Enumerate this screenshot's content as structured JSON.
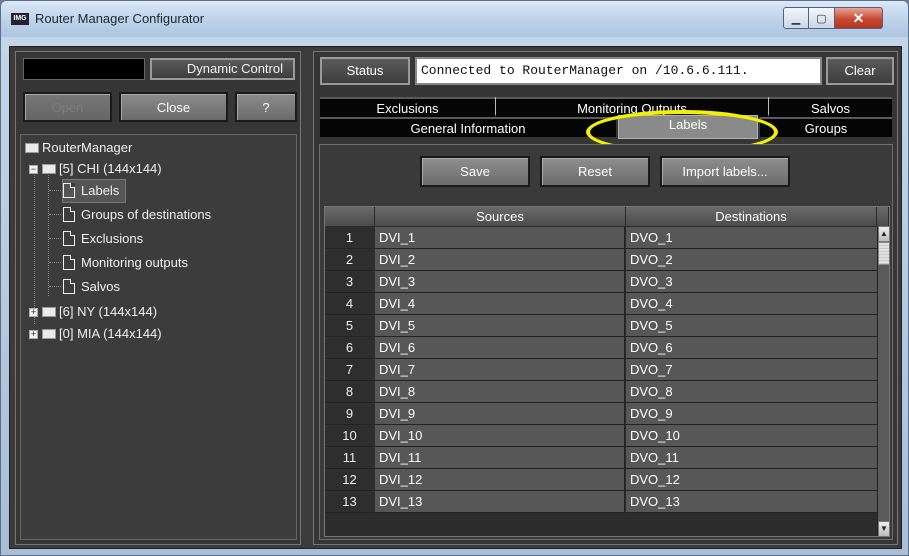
{
  "window": {
    "title": "Router Manager Configurator",
    "icon_text": "IMG",
    "minimize_symbol": "▁",
    "maximize_symbol": "▢",
    "close_symbol": "✕"
  },
  "left": {
    "dynamic_control_label": "Dynamic Control",
    "buttons": {
      "open": "Open",
      "close": "Close",
      "help": "?"
    },
    "tree": {
      "root": "RouterManager",
      "nodes": [
        {
          "label": "[5] CHI (144x144)",
          "expander": "−"
        },
        {
          "label": "[6] NY (144x144)",
          "expander": "+"
        },
        {
          "label": "[0] MIA (144x144)",
          "expander": "+"
        }
      ],
      "children": [
        "Labels",
        "Groups of destinations",
        "Exclusions",
        "Monitoring outputs",
        "Salvos"
      ]
    }
  },
  "right": {
    "status_label": "Status",
    "status_text": "Connected to RouterManager on /10.6.6.111.",
    "clear_label": "Clear",
    "tabs_row1": [
      "Exclusions",
      "Monitoring Outputs",
      "Salvos"
    ],
    "tabs_row2": [
      "General Information",
      "Labels",
      "Groups"
    ],
    "active_tab": "Labels",
    "actions": {
      "save": "Save",
      "reset": "Reset",
      "import": "Import labels..."
    },
    "table": {
      "headers": [
        "",
        "Sources",
        "Destinations"
      ],
      "rows": [
        [
          "1",
          "DVI_1",
          "DVO_1"
        ],
        [
          "2",
          "DVI_2",
          "DVO_2"
        ],
        [
          "3",
          "DVI_3",
          "DVO_3"
        ],
        [
          "4",
          "DVI_4",
          "DVO_4"
        ],
        [
          "5",
          "DVI_5",
          "DVO_5"
        ],
        [
          "6",
          "DVI_6",
          "DVO_6"
        ],
        [
          "7",
          "DVI_7",
          "DVO_7"
        ],
        [
          "8",
          "DVI_8",
          "DVO_8"
        ],
        [
          "9",
          "DVI_9",
          "DVO_9"
        ],
        [
          "10",
          "DVI_10",
          "DVO_10"
        ],
        [
          "11",
          "DVI_11",
          "DVO_11"
        ],
        [
          "12",
          "DVI_12",
          "DVO_12"
        ],
        [
          "13",
          "DVI_13",
          "DVO_13"
        ]
      ],
      "scroll_up": "▲",
      "scroll_down": "▼"
    }
  },
  "colors": {
    "highlight": "#f3f000",
    "panel": "#363636",
    "cell": "#575757"
  }
}
